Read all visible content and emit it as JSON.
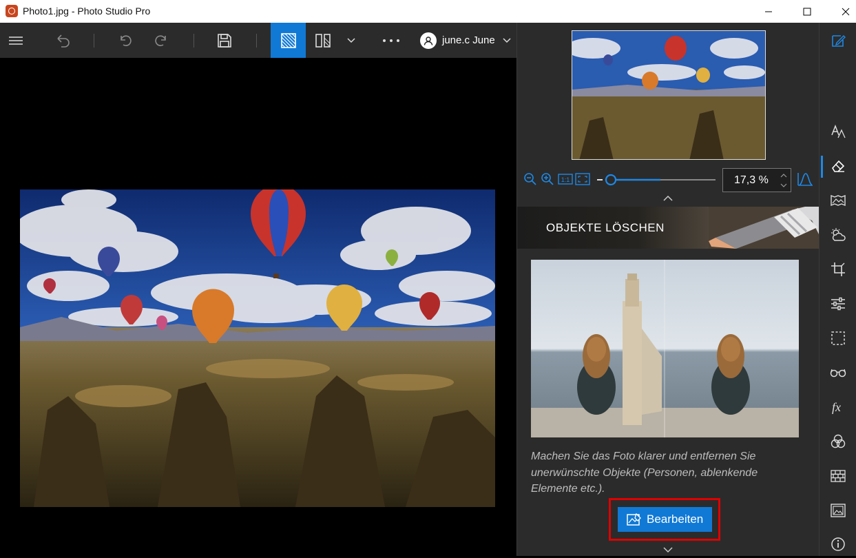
{
  "window": {
    "title": "Photo1.jpg - Photo Studio Pro"
  },
  "toolbar": {
    "user_name": "june.c June"
  },
  "zoom": {
    "value": "17,3 %",
    "level_fraction": 0.5
  },
  "panel": {
    "banner_title": "OBJEKTE LÖSCHEN",
    "description": "Machen Sie das Foto klarer und entfernen Sie unerwünschte Objekte (Personen, ablenkende Elemente etc.).",
    "edit_button_label": "Bearbeiten"
  },
  "colors": {
    "accent": "#1079d6",
    "highlight": "#e00000",
    "panel_bg": "#2b2b2b"
  },
  "icons": {
    "toolbar": [
      "menu-icon",
      "undo-all-icon",
      "undo-icon",
      "redo-icon",
      "save-icon",
      "single-view-icon",
      "compare-view-icon",
      "chevron-down-icon",
      "more-icon",
      "user-icon"
    ],
    "rail": [
      "edit-icon",
      "text-icon",
      "eraser-icon",
      "landscape-icon",
      "weather-icon",
      "crop-icon",
      "sliders-icon",
      "selection-icon",
      "glasses-icon",
      "fx-icon",
      "color-circles-icon",
      "brick-wall-icon",
      "picture-icon",
      "info-icon"
    ]
  }
}
